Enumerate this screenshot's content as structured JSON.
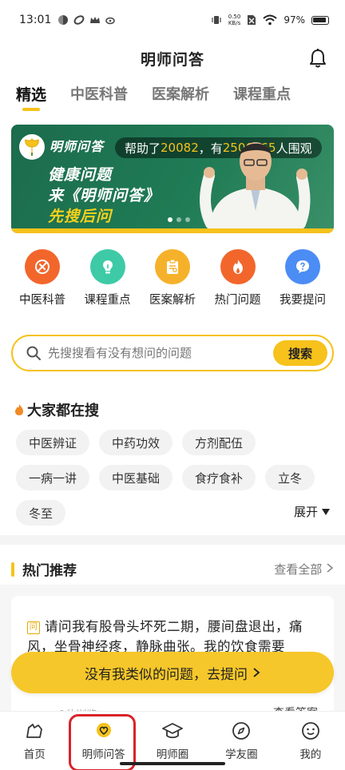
{
  "status_bar": {
    "time": "13:01",
    "net_speed_value": "0.50",
    "net_speed_unit": "KB/s",
    "battery": "97%"
  },
  "header": {
    "title": "明师问答"
  },
  "tabs": [
    {
      "label": "精选",
      "active": true
    },
    {
      "label": "中医科普",
      "active": false
    },
    {
      "label": "医案解析",
      "active": false
    },
    {
      "label": "课程重点",
      "active": false
    }
  ],
  "banner": {
    "brand": "明师问答",
    "helped_prefix": "帮助了",
    "helped_count": "20082",
    "helped_mid": "，有",
    "viewers_count": "2506665",
    "helped_suffix": "人围观",
    "slogan_1": "健康问题",
    "slogan_2": "来《明师问答》",
    "slogan_3": "先搜后问",
    "slide_count": 3,
    "active_slide": 1
  },
  "quick_nav": [
    {
      "label": "中医科普",
      "icon": "science-icon",
      "color": "#f2662c"
    },
    {
      "label": "课程重点",
      "icon": "bulb-icon",
      "color": "#3ecaa6"
    },
    {
      "label": "医案解析",
      "icon": "clipboard-icon",
      "color": "#f6b12b"
    },
    {
      "label": "热门问题",
      "icon": "flame-icon",
      "color": "#f2662c"
    },
    {
      "label": "我要提问",
      "icon": "question-icon",
      "color": "#4c8cf5"
    }
  ],
  "search": {
    "placeholder": "先搜搜看有没有想问的问题",
    "button": "搜索"
  },
  "hot_searches": {
    "title": "大家都在搜",
    "items": [
      "中医辨证",
      "中药功效",
      "方剂配伍",
      "一病一讲",
      "中医基础",
      "食疗食补",
      "立冬",
      "冬至"
    ],
    "expand": "展开"
  },
  "recommend": {
    "title": "热门推荐",
    "view_all": "查看全部",
    "card": {
      "badge": "问",
      "question": "请问我有股骨头坏死二期，腰间盘退出，痛风，坐骨神经疼，静脉曲张。我的饮食需要",
      "footer_left": "1位浏览",
      "footer_right": "查看答案"
    }
  },
  "ask_bar": {
    "label": "没有我类似的问题，去提问"
  },
  "bottom_nav": [
    {
      "label": "首页",
      "icon": "home-icon"
    },
    {
      "label": "明师问答",
      "icon": "qa-bubble-icon",
      "active": true
    },
    {
      "label": "明师圈",
      "icon": "graduation-cap-icon"
    },
    {
      "label": "学友圈",
      "icon": "compass-icon"
    },
    {
      "label": "我的",
      "icon": "smiley-icon"
    }
  ]
}
